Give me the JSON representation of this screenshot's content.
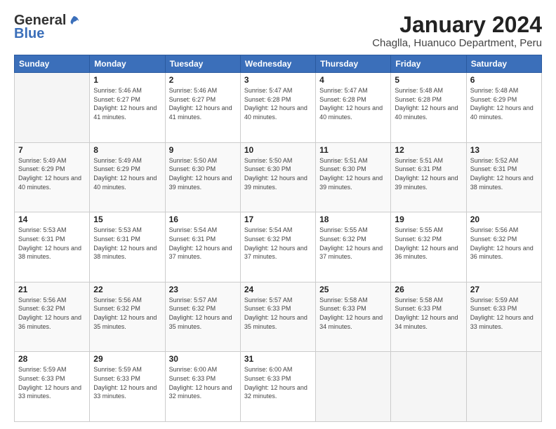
{
  "logo": {
    "general": "General",
    "blue": "Blue"
  },
  "title": "January 2024",
  "subtitle": "Chaglla, Huanuco Department, Peru",
  "days_header": [
    "Sunday",
    "Monday",
    "Tuesday",
    "Wednesday",
    "Thursday",
    "Friday",
    "Saturday"
  ],
  "weeks": [
    [
      {
        "day": "",
        "sunrise": "",
        "sunset": "",
        "daylight": ""
      },
      {
        "day": "1",
        "sunrise": "5:46 AM",
        "sunset": "6:27 PM",
        "daylight": "12 hours and 41 minutes."
      },
      {
        "day": "2",
        "sunrise": "5:46 AM",
        "sunset": "6:27 PM",
        "daylight": "12 hours and 41 minutes."
      },
      {
        "day": "3",
        "sunrise": "5:47 AM",
        "sunset": "6:28 PM",
        "daylight": "12 hours and 40 minutes."
      },
      {
        "day": "4",
        "sunrise": "5:47 AM",
        "sunset": "6:28 PM",
        "daylight": "12 hours and 40 minutes."
      },
      {
        "day": "5",
        "sunrise": "5:48 AM",
        "sunset": "6:28 PM",
        "daylight": "12 hours and 40 minutes."
      },
      {
        "day": "6",
        "sunrise": "5:48 AM",
        "sunset": "6:29 PM",
        "daylight": "12 hours and 40 minutes."
      }
    ],
    [
      {
        "day": "7",
        "sunrise": "5:49 AM",
        "sunset": "6:29 PM",
        "daylight": "12 hours and 40 minutes."
      },
      {
        "day": "8",
        "sunrise": "5:49 AM",
        "sunset": "6:29 PM",
        "daylight": "12 hours and 40 minutes."
      },
      {
        "day": "9",
        "sunrise": "5:50 AM",
        "sunset": "6:30 PM",
        "daylight": "12 hours and 39 minutes."
      },
      {
        "day": "10",
        "sunrise": "5:50 AM",
        "sunset": "6:30 PM",
        "daylight": "12 hours and 39 minutes."
      },
      {
        "day": "11",
        "sunrise": "5:51 AM",
        "sunset": "6:30 PM",
        "daylight": "12 hours and 39 minutes."
      },
      {
        "day": "12",
        "sunrise": "5:51 AM",
        "sunset": "6:31 PM",
        "daylight": "12 hours and 39 minutes."
      },
      {
        "day": "13",
        "sunrise": "5:52 AM",
        "sunset": "6:31 PM",
        "daylight": "12 hours and 38 minutes."
      }
    ],
    [
      {
        "day": "14",
        "sunrise": "5:53 AM",
        "sunset": "6:31 PM",
        "daylight": "12 hours and 38 minutes."
      },
      {
        "day": "15",
        "sunrise": "5:53 AM",
        "sunset": "6:31 PM",
        "daylight": "12 hours and 38 minutes."
      },
      {
        "day": "16",
        "sunrise": "5:54 AM",
        "sunset": "6:31 PM",
        "daylight": "12 hours and 37 minutes."
      },
      {
        "day": "17",
        "sunrise": "5:54 AM",
        "sunset": "6:32 PM",
        "daylight": "12 hours and 37 minutes."
      },
      {
        "day": "18",
        "sunrise": "5:55 AM",
        "sunset": "6:32 PM",
        "daylight": "12 hours and 37 minutes."
      },
      {
        "day": "19",
        "sunrise": "5:55 AM",
        "sunset": "6:32 PM",
        "daylight": "12 hours and 36 minutes."
      },
      {
        "day": "20",
        "sunrise": "5:56 AM",
        "sunset": "6:32 PM",
        "daylight": "12 hours and 36 minutes."
      }
    ],
    [
      {
        "day": "21",
        "sunrise": "5:56 AM",
        "sunset": "6:32 PM",
        "daylight": "12 hours and 36 minutes."
      },
      {
        "day": "22",
        "sunrise": "5:56 AM",
        "sunset": "6:32 PM",
        "daylight": "12 hours and 35 minutes."
      },
      {
        "day": "23",
        "sunrise": "5:57 AM",
        "sunset": "6:32 PM",
        "daylight": "12 hours and 35 minutes."
      },
      {
        "day": "24",
        "sunrise": "5:57 AM",
        "sunset": "6:33 PM",
        "daylight": "12 hours and 35 minutes."
      },
      {
        "day": "25",
        "sunrise": "5:58 AM",
        "sunset": "6:33 PM",
        "daylight": "12 hours and 34 minutes."
      },
      {
        "day": "26",
        "sunrise": "5:58 AM",
        "sunset": "6:33 PM",
        "daylight": "12 hours and 34 minutes."
      },
      {
        "day": "27",
        "sunrise": "5:59 AM",
        "sunset": "6:33 PM",
        "daylight": "12 hours and 33 minutes."
      }
    ],
    [
      {
        "day": "28",
        "sunrise": "5:59 AM",
        "sunset": "6:33 PM",
        "daylight": "12 hours and 33 minutes."
      },
      {
        "day": "29",
        "sunrise": "5:59 AM",
        "sunset": "6:33 PM",
        "daylight": "12 hours and 33 minutes."
      },
      {
        "day": "30",
        "sunrise": "6:00 AM",
        "sunset": "6:33 PM",
        "daylight": "12 hours and 32 minutes."
      },
      {
        "day": "31",
        "sunrise": "6:00 AM",
        "sunset": "6:33 PM",
        "daylight": "12 hours and 32 minutes."
      },
      {
        "day": "",
        "sunrise": "",
        "sunset": "",
        "daylight": ""
      },
      {
        "day": "",
        "sunrise": "",
        "sunset": "",
        "daylight": ""
      },
      {
        "day": "",
        "sunrise": "",
        "sunset": "",
        "daylight": ""
      }
    ]
  ]
}
